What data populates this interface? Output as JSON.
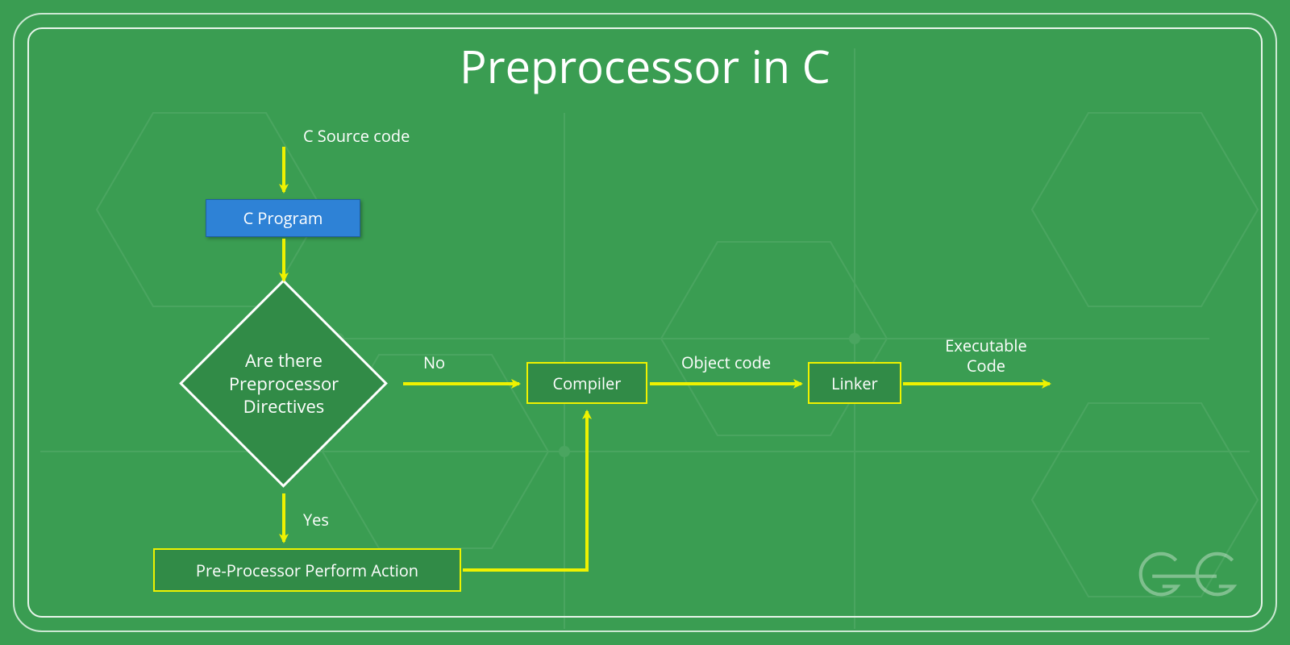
{
  "title": "Preprocessor in C",
  "labels": {
    "source": "C Source code",
    "object": "Object code",
    "exec_line1": "Executable",
    "exec_line2": "Code",
    "no": "No",
    "yes": "Yes"
  },
  "nodes": {
    "c_program": "C Program",
    "decision_line1": "Are there",
    "decision_line2": "Preprocessor",
    "decision_line3": "Directives",
    "compiler": "Compiler",
    "linker": "Linker",
    "preprocessor_action": "Pre-Processor Perform Action"
  },
  "colors": {
    "bg": "#3a9d52",
    "arrow": "#eef200",
    "box_border": "#eef200",
    "diamond_border": "#ffffff",
    "blue_box": "#2e82d6",
    "text": "#ffffff"
  }
}
